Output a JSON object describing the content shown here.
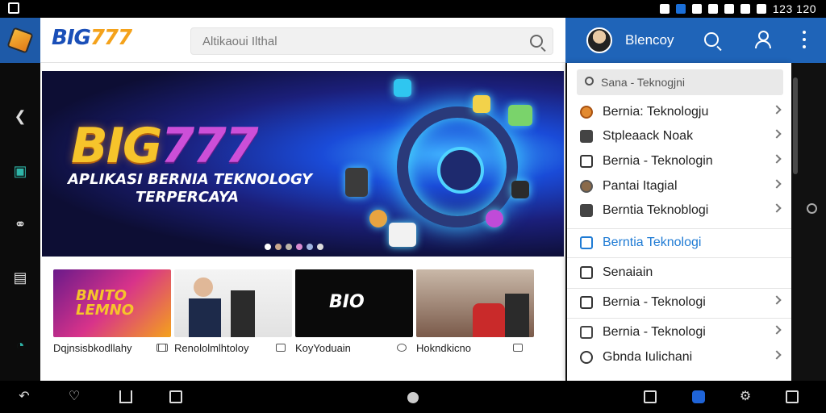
{
  "status_bar": {
    "time": "123 120"
  },
  "header": {
    "logo_part1": "BIG",
    "logo_part2": "777",
    "search_placeholder": "Altikaoui Ilthal"
  },
  "account": {
    "name": "Blencoy"
  },
  "banner": {
    "title_part1": "BIG",
    "title_part2": "777",
    "subtitle_line1": "APLIKASI BERNIA TEKNOLOGY",
    "subtitle_line2": "TERPERCAYA",
    "slides": 6
  },
  "cards": [
    {
      "label": "Dqjnsisbkodllahy",
      "image_text": "BNITO LEMNO"
    },
    {
      "label": "Renololmlhtoloy",
      "image_text": ""
    },
    {
      "label": "KoyYoduain",
      "image_text": "BIO"
    },
    {
      "label": "Hokndkicno",
      "image_text": ""
    }
  ],
  "panel": {
    "search_text": "Sana - Teknogjni",
    "items": [
      {
        "label": "Bernia: Teknologju",
        "icon": "globe-icon",
        "has_chevron": true
      },
      {
        "label": "Stpleaack Noak",
        "icon": "mail-icon",
        "has_chevron": true
      },
      {
        "label": "Bernia - Teknologin",
        "icon": "play-icon",
        "has_chevron": true
      },
      {
        "label": "Pantai Itagial",
        "icon": "badge-icon",
        "has_chevron": true
      },
      {
        "label": "Berntia Teknoblogi",
        "icon": "house-icon",
        "has_chevron": true
      },
      {
        "label": "Berntia Teknologi",
        "icon": "image-icon",
        "has_chevron": false,
        "active": true
      },
      {
        "label": "Senaiain",
        "icon": "plus-icon",
        "has_chevron": false
      },
      {
        "label": "Bernia - Teknologi",
        "icon": "check-icon",
        "has_chevron": true
      },
      {
        "label": "Bernia - Teknologi",
        "icon": "file-icon",
        "has_chevron": true
      },
      {
        "label": "Gbnda Iulichani",
        "icon": "people-icon",
        "has_chevron": true
      }
    ]
  },
  "colors": {
    "brand_blue": "#1f64b8",
    "accent_orange": "#f6c42b",
    "link_blue": "#1f7bd4"
  }
}
